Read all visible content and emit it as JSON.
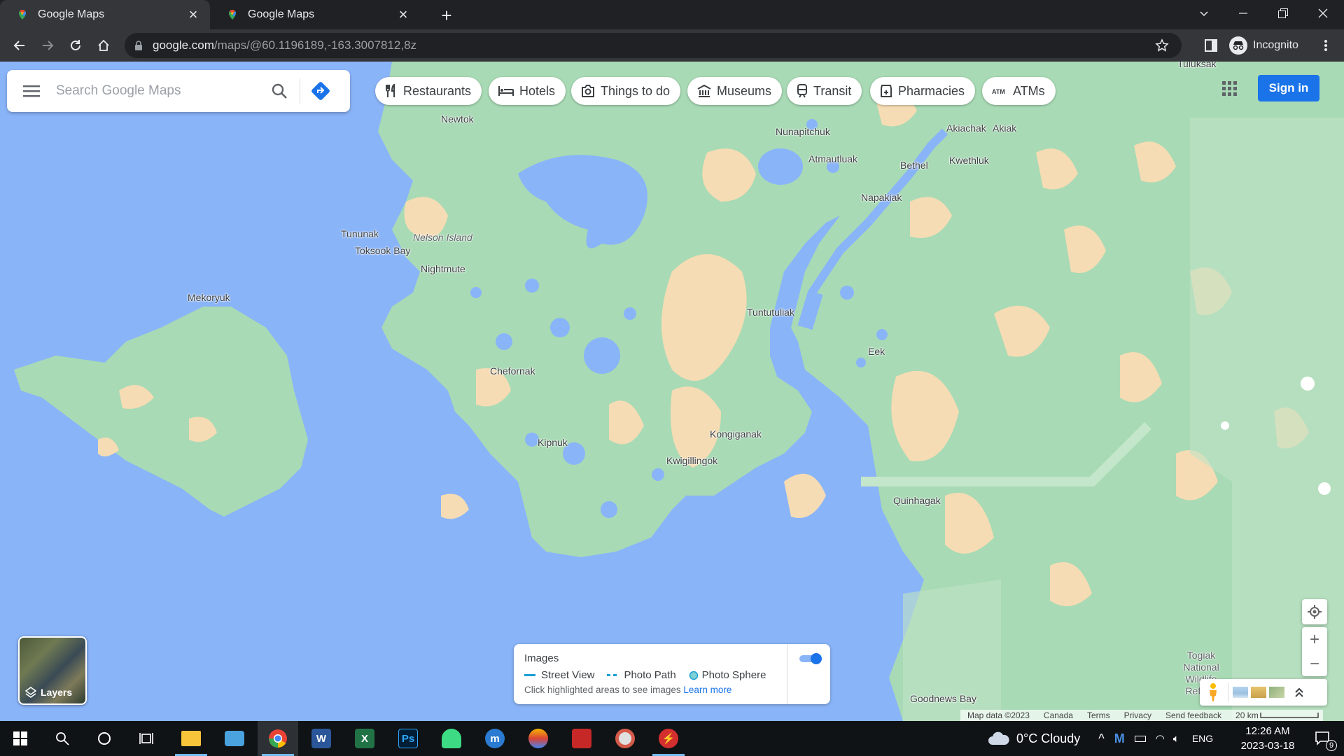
{
  "browser": {
    "tabs": [
      {
        "title": "Google Maps",
        "active": true
      },
      {
        "title": "Google Maps",
        "active": false
      }
    ],
    "url_host": "google.com",
    "url_path": "/maps/@60.1196189,-163.3007812,8z",
    "profile_label": "Incognito"
  },
  "maps": {
    "search_placeholder": "Search Google Maps",
    "chips": [
      {
        "label": "Restaurants",
        "icon": "fork-knife-icon"
      },
      {
        "label": "Hotels",
        "icon": "bed-icon"
      },
      {
        "label": "Things to do",
        "icon": "camera-icon"
      },
      {
        "label": "Museums",
        "icon": "museum-icon"
      },
      {
        "label": "Transit",
        "icon": "train-icon"
      },
      {
        "label": "Pharmacies",
        "icon": "pharmacy-icon"
      },
      {
        "label": "ATMs",
        "icon": "atm-icon"
      }
    ],
    "sign_in_label": "Sign in",
    "layers_label": "Layers",
    "places": [
      {
        "name": "Tuluksak"
      },
      {
        "name": "Newtok"
      },
      {
        "name": "Nunapitchuk"
      },
      {
        "name": "Akiachak"
      },
      {
        "name": "Akiak"
      },
      {
        "name": "Atmautluak"
      },
      {
        "name": "Bethel"
      },
      {
        "name": "Kwethluk"
      },
      {
        "name": "Napakiak"
      },
      {
        "name": "Tununak"
      },
      {
        "name": "Nelson Island"
      },
      {
        "name": "Toksook Bay"
      },
      {
        "name": "Nightmute"
      },
      {
        "name": "Mekoryuk"
      },
      {
        "name": "Tuntutuliak"
      },
      {
        "name": "Eek"
      },
      {
        "name": "Chefornak"
      },
      {
        "name": "Kipnuk"
      },
      {
        "name": "Kongiganak"
      },
      {
        "name": "Kwigillingok"
      },
      {
        "name": "Quinhagak"
      },
      {
        "name": "Goodnews Bay"
      },
      {
        "name": "Togiak National Wildlife Refuge"
      }
    ],
    "images_panel": {
      "title": "Images",
      "street_view": "Street View",
      "photo_path": "Photo Path",
      "photo_sphere": "Photo Sphere",
      "hint": "Click highlighted areas to see images",
      "learn_more": "Learn more"
    },
    "attribution": {
      "map_data": "Map data ©2023",
      "region": "Canada",
      "terms": "Terms",
      "privacy": "Privacy",
      "feedback": "Send feedback",
      "scale": "20 km"
    },
    "colors": {
      "water": "#8ab4f8",
      "land": "#a8dab5",
      "sand": "#f5dcb4",
      "accent": "#1a73e8"
    }
  },
  "taskbar": {
    "weather": "0°C  Cloudy",
    "language": "ENG",
    "time": "12:26 AM",
    "date": "2023-03-18",
    "notifications": "9"
  }
}
